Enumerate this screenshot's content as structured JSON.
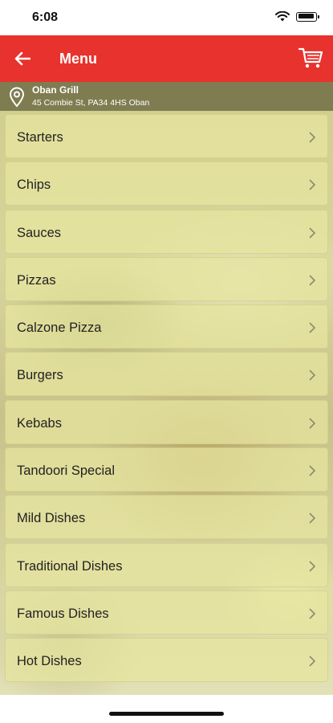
{
  "status_bar": {
    "time": "6:08"
  },
  "header": {
    "title": "Menu"
  },
  "location": {
    "name": "Oban Grill",
    "address": "45 Combie St, PA34 4HS Oban"
  },
  "menu": {
    "items": [
      {
        "label": "Starters"
      },
      {
        "label": "Chips"
      },
      {
        "label": "Sauces"
      },
      {
        "label": "Pizzas"
      },
      {
        "label": "Calzone Pizza"
      },
      {
        "label": "Burgers"
      },
      {
        "label": "Kebabs"
      },
      {
        "label": "Tandoori Special"
      },
      {
        "label": "Mild Dishes"
      },
      {
        "label": "Traditional Dishes"
      },
      {
        "label": "Famous Dishes"
      },
      {
        "label": "Hot Dishes"
      }
    ]
  },
  "colors": {
    "header_bg": "#e8322d",
    "header_text": "#ffffff",
    "item_bg": "#e8e6a0"
  },
  "icons": {
    "back": "arrow-left-icon",
    "cart": "cart-icon",
    "location": "map-pin-icon",
    "chevron": "chevron-right-icon",
    "wifi": "wifi-icon",
    "battery": "battery-icon"
  }
}
